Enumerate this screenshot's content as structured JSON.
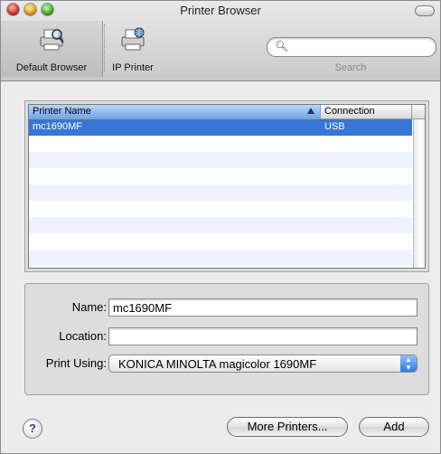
{
  "window": {
    "title": "Printer Browser"
  },
  "toolbar": {
    "items": [
      {
        "label": "Default Browser",
        "icon": "printer-magnifier-icon",
        "selected": true
      },
      {
        "label": "IP Printer",
        "icon": "network-printer-icon",
        "selected": false
      }
    ],
    "search": {
      "value": "",
      "label": "Search"
    }
  },
  "printer_list": {
    "columns": [
      "Printer Name",
      "Connection"
    ],
    "sort_column": "Printer Name",
    "rows": [
      {
        "name": "mc1690MF",
        "connection": "USB",
        "selected": true
      }
    ]
  },
  "details": {
    "name_label": "Name:",
    "name_value": "mc1690MF",
    "location_label": "Location:",
    "location_value": "",
    "print_using_label": "Print Using:",
    "print_using_value": "KONICA MINOLTA magicolor 1690MF"
  },
  "buttons": {
    "help": "?",
    "more_printers": "More Printers...",
    "add": "Add"
  },
  "colors": {
    "selection": "#3875d7",
    "alt_row": "#edf3fe",
    "header_sorted": "#6fa6e8"
  }
}
